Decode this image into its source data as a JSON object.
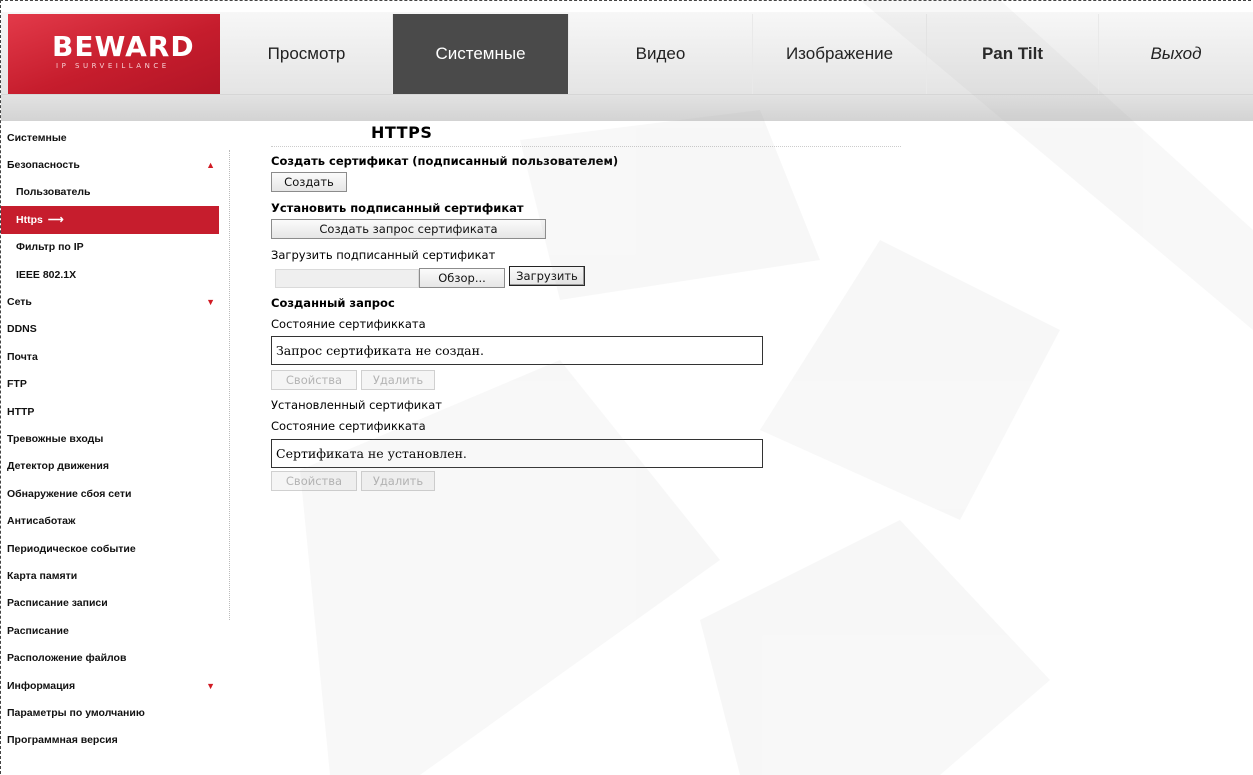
{
  "logo": {
    "name": "BEWARD",
    "tagline": "IP SURVEILLANCE"
  },
  "nav": [
    {
      "label": "Просмотр",
      "active": false
    },
    {
      "label": "Системные",
      "active": true
    },
    {
      "label": "Видео",
      "active": false
    },
    {
      "label": "Изображение",
      "active": false
    },
    {
      "label": "Pan Tilt",
      "active": false
    },
    {
      "label": "Выход",
      "active": false
    }
  ],
  "sidebar": {
    "items": [
      {
        "label": "Системные"
      },
      {
        "label": "Безопасность",
        "arrow": "up"
      },
      {
        "label": "Пользователь",
        "sub": true
      },
      {
        "label": "Https",
        "sub": true,
        "active": true
      },
      {
        "label": "Фильтр по IP",
        "sub": true
      },
      {
        "label": "IEEE 802.1X",
        "sub": true
      },
      {
        "label": "Сеть",
        "arrow": "down"
      },
      {
        "label": "DDNS"
      },
      {
        "label": "Почта"
      },
      {
        "label": "FTP"
      },
      {
        "label": "HTTP"
      },
      {
        "label": "Тревожные входы"
      },
      {
        "label": "Детектор движения"
      },
      {
        "label": "Обнаружение сбоя сети"
      },
      {
        "label": "Антисаботаж"
      },
      {
        "label": "Периодическое событие"
      },
      {
        "label": "Карта памяти"
      },
      {
        "label": "Расписание записи"
      },
      {
        "label": "Расписание"
      },
      {
        "label": "Расположение файлов"
      },
      {
        "label": "Информация",
        "arrow": "down"
      },
      {
        "label": "Параметры по умолчанию"
      },
      {
        "label": "Программная версия"
      }
    ]
  },
  "content": {
    "title": "HTTPS",
    "create_cert_heading": "Создать сертификат (подписанный пользователем)",
    "create_button": "Создать",
    "install_signed_heading": "Установить подписанный сертификат",
    "create_request_button": "Создать запрос сертификата",
    "upload_label": "Загрузить подписанный сертификат",
    "browse_button": "Обзор...",
    "upload_button": "Загрузить",
    "created_request_heading": "Созданный запрос",
    "status_label_1": "Состояние сертификката",
    "status_value_1": "Запрос сертификата не создан.",
    "properties_button": "Свойства",
    "delete_button": "Удалить",
    "installed_cert_label": "Установленный сертификат",
    "status_label_2": "Состояние сертификката",
    "status_value_2": "Сертификата не установлен."
  },
  "colors": {
    "brand_red": "#c61d2d",
    "active_tab": "#4a4a4a",
    "arrow_red": "#d11b24"
  }
}
